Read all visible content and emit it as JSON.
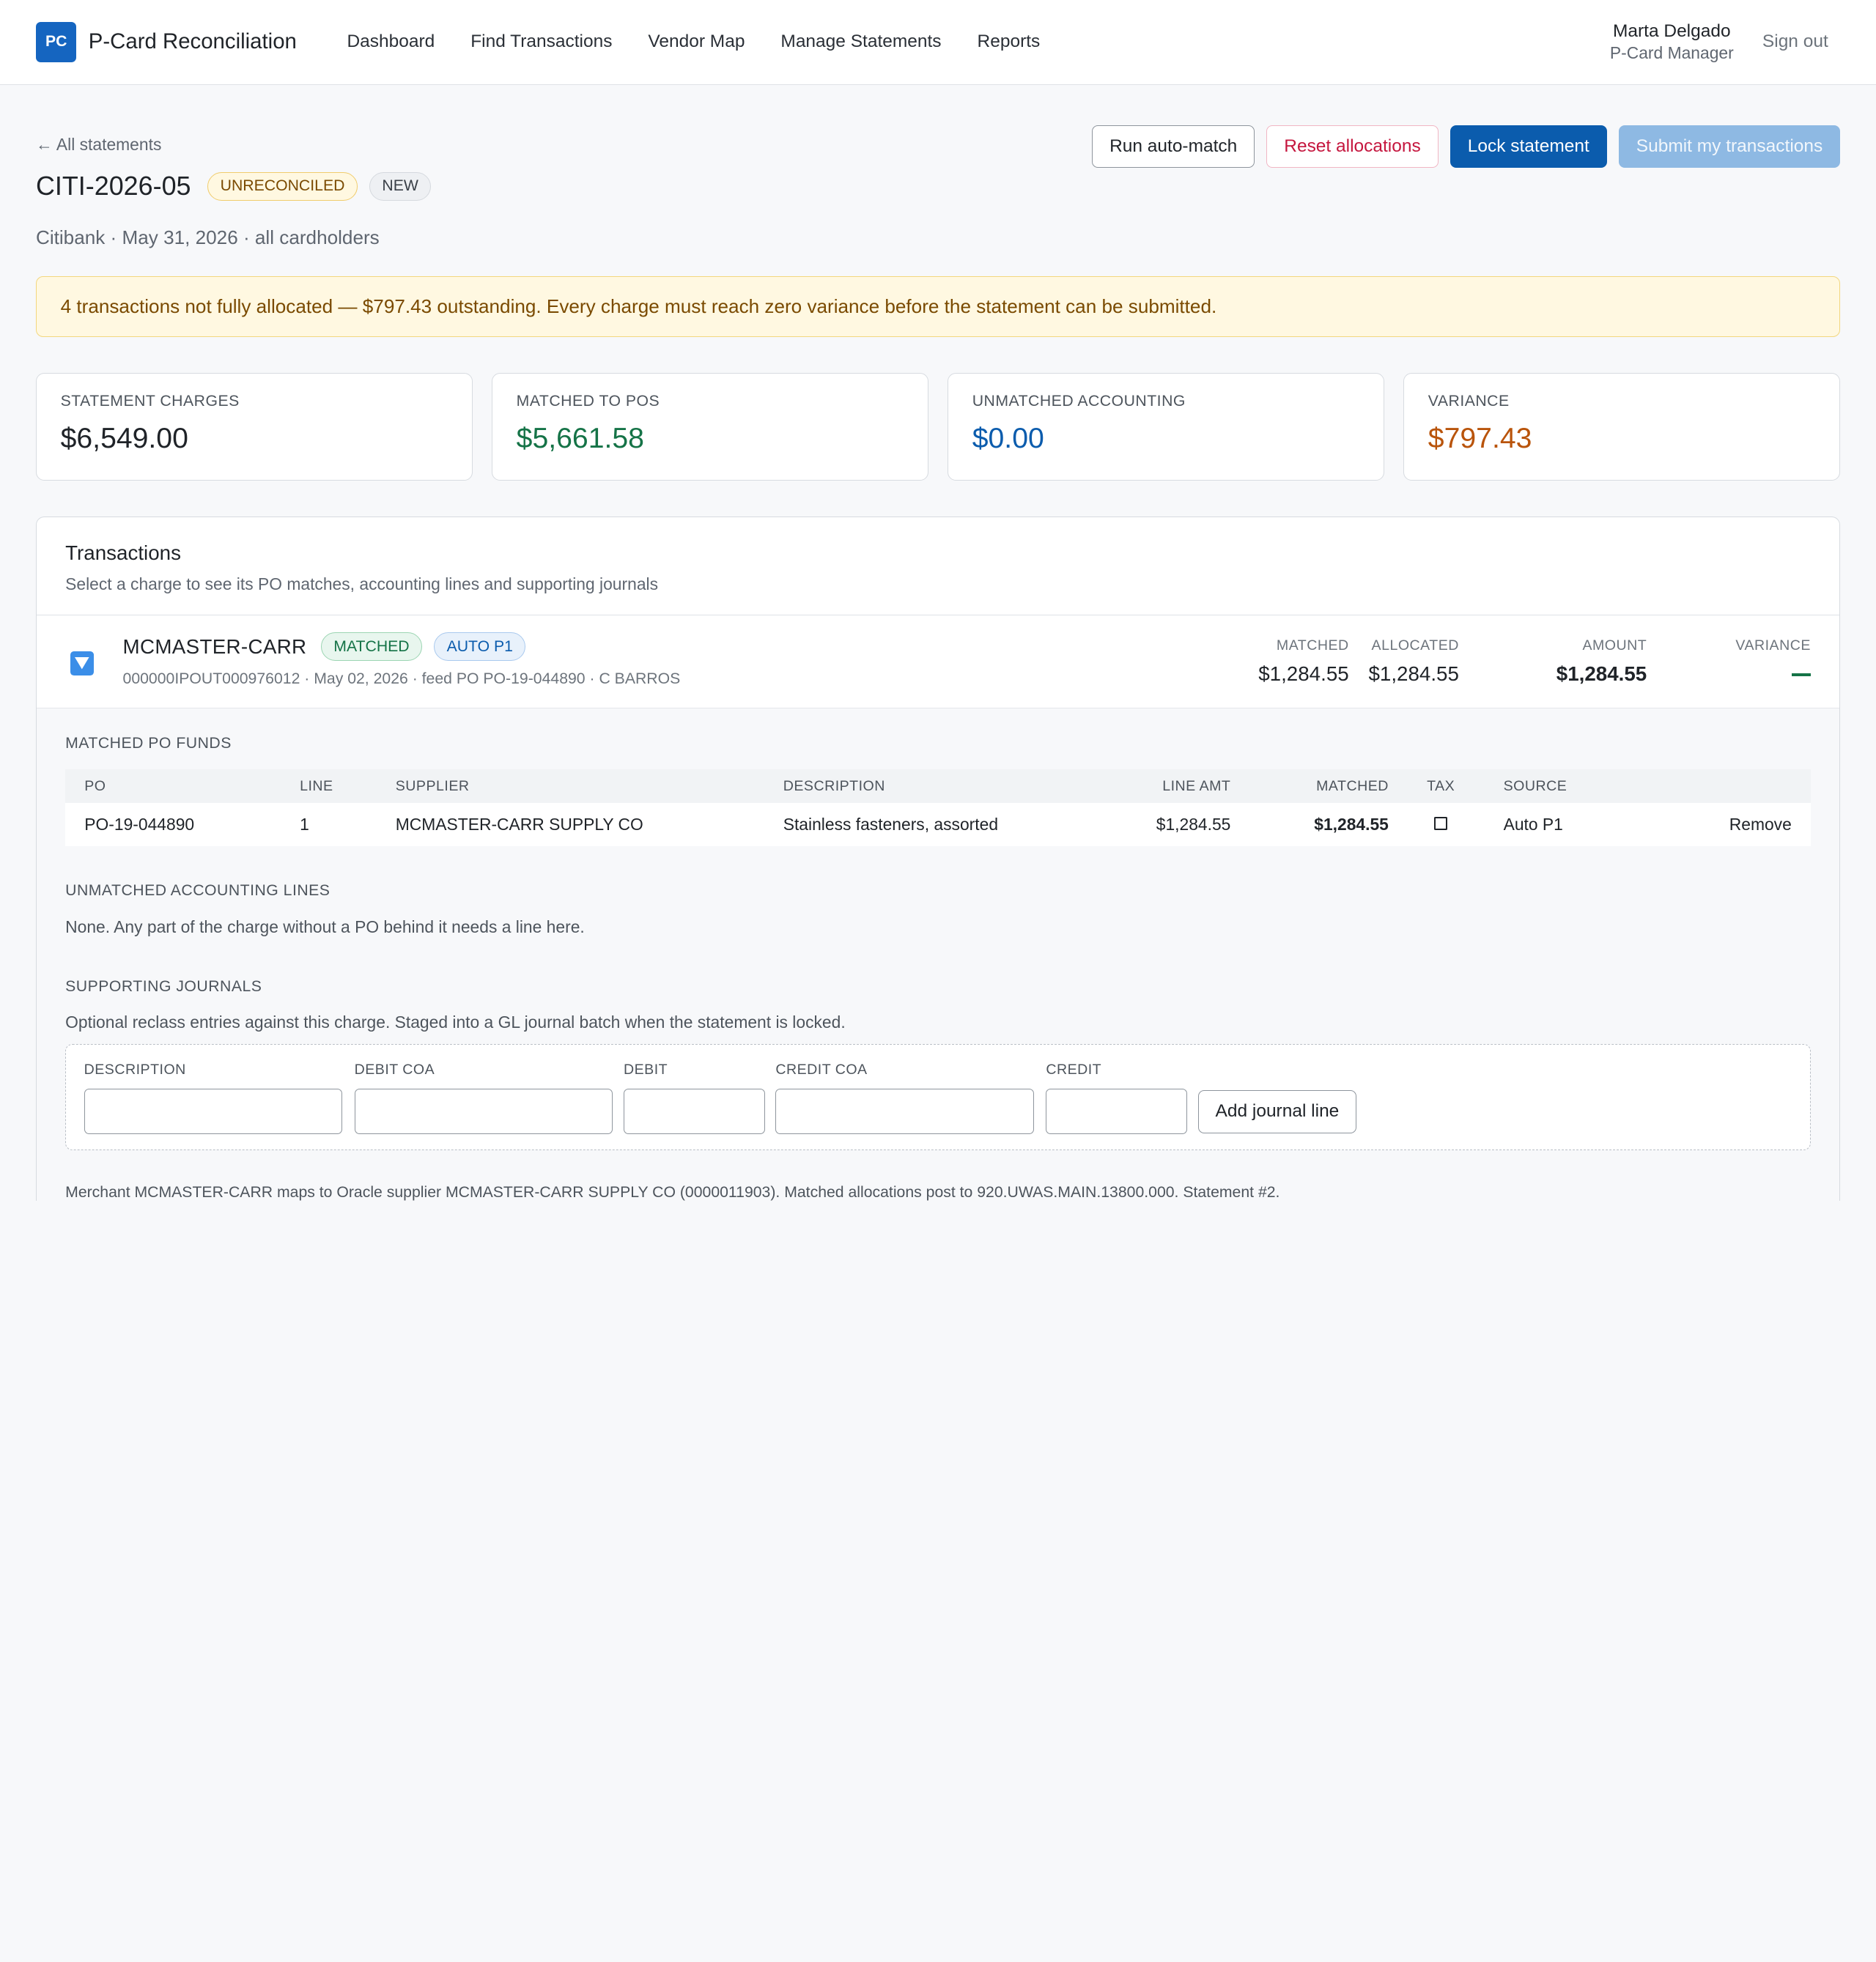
{
  "app": {
    "logo_text": "PC",
    "title": "P-Card Reconciliation"
  },
  "nav": {
    "items": [
      "Dashboard",
      "Find Transactions",
      "Vendor Map",
      "Manage Statements",
      "Reports"
    ]
  },
  "user": {
    "name": "Marta Delgado",
    "role": "P-Card Manager",
    "signout": "Sign out"
  },
  "header": {
    "back": "← All statements",
    "title": "CITI-2026-05",
    "status_badge": "UNRECONCILED",
    "new_badge": "NEW",
    "subtitle": "Citibank · May 31, 2026 · all cardholders"
  },
  "actions": {
    "auto_match": "Run auto-match",
    "reset": "Reset allocations",
    "lock": "Lock statement",
    "submit": "Submit my transactions"
  },
  "alert": "4 transactions not fully allocated — $797.43 outstanding. Every charge must reach zero variance before the statement can be submitted.",
  "summary": [
    {
      "label": "STATEMENT CHARGES",
      "value": "$6,549.00",
      "color": "#1f2328"
    },
    {
      "label": "MATCHED TO POS",
      "value": "$5,661.58",
      "color": "#157347"
    },
    {
      "label": "UNMATCHED ACCOUNTING",
      "value": "$0.00",
      "color": "#0b5cad"
    },
    {
      "label": "VARIANCE",
      "value": "$797.43",
      "color": "#b9540b"
    }
  ],
  "transactions": {
    "title": "Transactions",
    "subtitle": "Select a charge to see its PO matches, accounting lines and supporting journals",
    "rows": [
      {
        "merchant": "MCMASTER-CARR",
        "status": "MATCHED",
        "source": "AUTO P1",
        "meta": "000000IPOUT000976012 · May 02, 2026 · feed PO PO-19-044890 · C BARROS",
        "matched_label": "MATCHED",
        "matched": "$1,284.55",
        "allocated_label": "ALLOCATED",
        "allocated": "$1,284.55",
        "amount_label": "AMOUNT",
        "amount": "$1,284.55",
        "variance_label": "VARIANCE",
        "expanded": true
      }
    ]
  },
  "detail": {
    "po_section": "MATCHED PO FUNDS",
    "po_columns": [
      "PO",
      "LINE",
      "SUPPLIER",
      "DESCRIPTION",
      "LINE AMT",
      "MATCHED",
      "TAX",
      "SOURCE"
    ],
    "po_rows": [
      {
        "po": "PO-19-044890",
        "line": "1",
        "supplier": "MCMASTER-CARR SUPPLY CO",
        "description": "Stainless fasteners, assorted",
        "line_amt": "$1,284.55",
        "matched": "$1,284.55",
        "tax": false,
        "source": "Auto P1",
        "action": "Remove"
      }
    ],
    "unmatched_section": "UNMATCHED ACCOUNTING LINES",
    "unmatched_text": "None. Any part of the charge without a PO behind it needs a line here.",
    "journals_section": "SUPPORTING JOURNALS",
    "journals_text": "Optional reclass entries against this charge. Staged into a GL journal batch when the statement is locked.",
    "journal_fields": {
      "description": "DESCRIPTION",
      "debit_coa": "DEBIT COA",
      "debit": "DEBIT",
      "credit_coa": "CREDIT COA",
      "credit": "CREDIT",
      "add_button": "Add journal line"
    },
    "footnote": "Merchant MCMASTER-CARR maps to Oracle supplier MCMASTER-CARR SUPPLY CO (0000011903). Matched allocations post to 920.UWAS.MAIN.13800.000. Statement #2."
  }
}
